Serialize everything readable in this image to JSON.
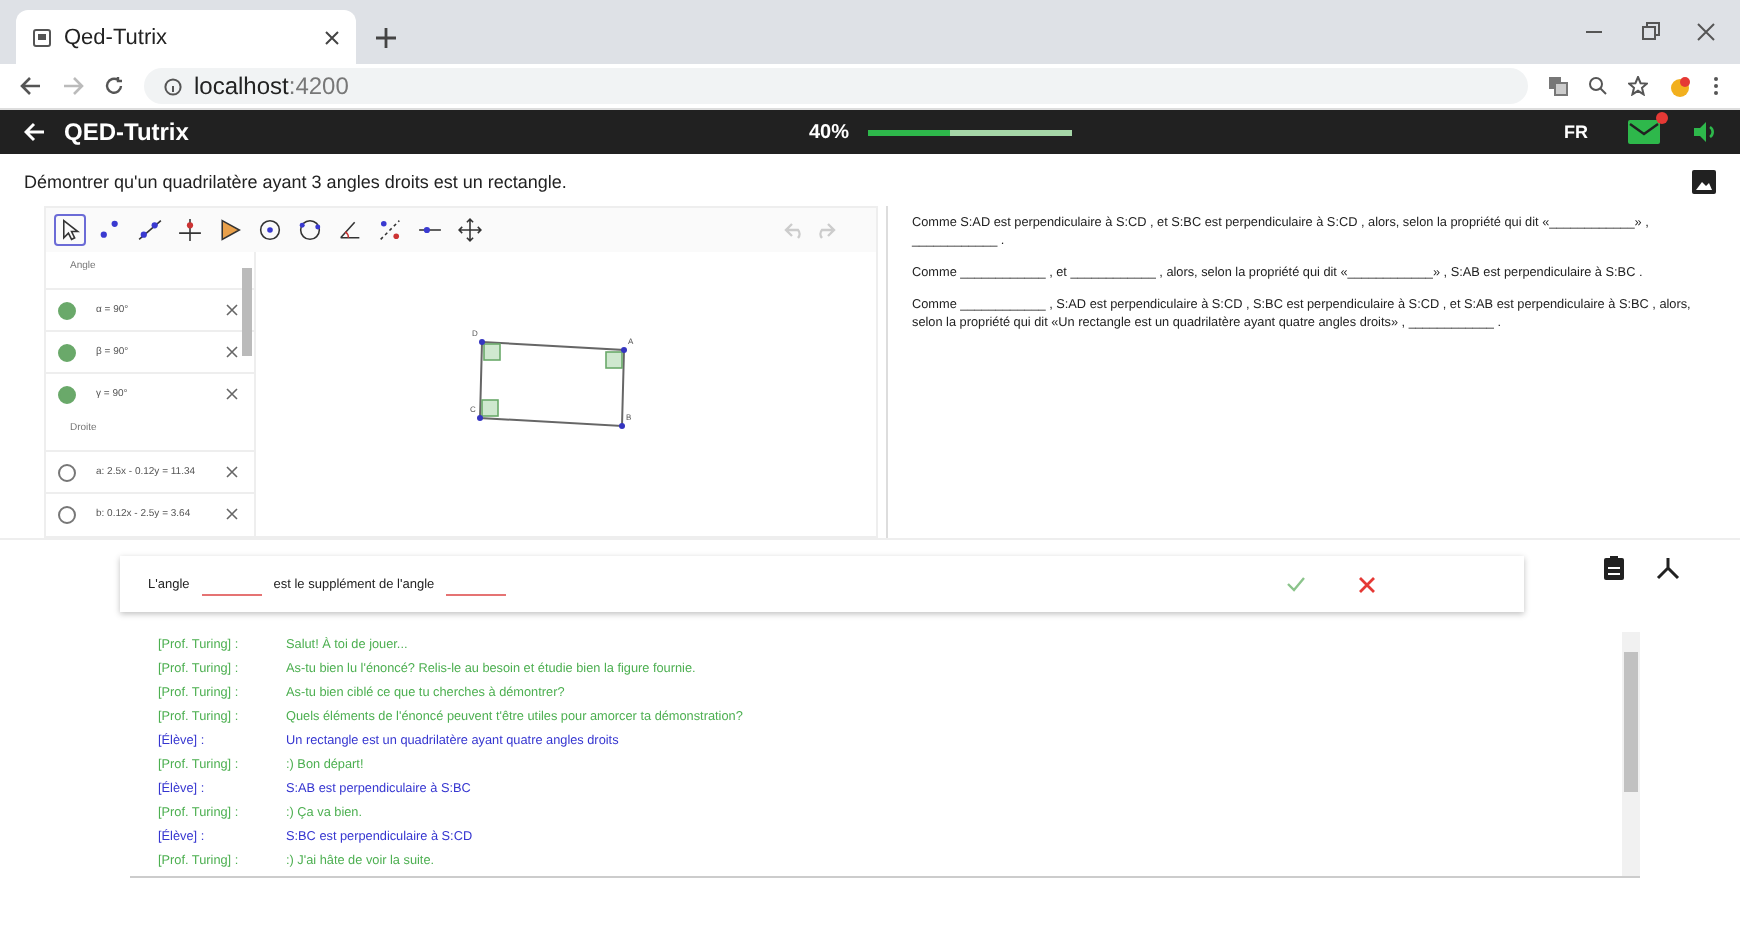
{
  "browser": {
    "tab_title": "Qed-Tutrix",
    "url_host": "localhost",
    "url_port": ":4200"
  },
  "app_bar": {
    "title": "QED-Tutrix",
    "progress_text": "40%",
    "level": 0.4,
    "language": "FR",
    "notification": true
  },
  "problem": {
    "statement": "Démontrer qu'un quadrilatère ayant 3 angles droits est un rectangle."
  },
  "geometry": {
    "tools": [
      {
        "kind": "move",
        "selected": true
      },
      {
        "kind": "point",
        "selected": false
      },
      {
        "kind": "line",
        "selected": false
      },
      {
        "kind": "perpendicular",
        "selected": false
      },
      {
        "kind": "polygon",
        "selected": false
      },
      {
        "kind": "circle",
        "selected": false
      },
      {
        "kind": "circle3",
        "selected": false
      },
      {
        "kind": "angle",
        "selected": false
      },
      {
        "kind": "reflect",
        "selected": false
      },
      {
        "kind": "slider",
        "selected": false
      },
      {
        "kind": "pan",
        "selected": false
      }
    ],
    "algebra": [
      {
        "title": "Angle",
        "items": [
          {
            "label": "α = 90°",
            "visible": true
          },
          {
            "label": "β = 90°",
            "visible": true
          },
          {
            "label": "γ = 90°",
            "visible": true
          }
        ]
      },
      {
        "title": "Droite",
        "items": [
          {
            "label": "a: 2.5x - 0.12y = 11.34",
            "visible": false
          },
          {
            "label": "b: 0.12x - 2.5y = 3.64",
            "visible": false
          }
        ]
      }
    ],
    "points": [
      "D",
      "A",
      "C",
      "B"
    ]
  },
  "proof": {
    "paragraphs": [
      "Comme S:AD est perpendiculaire à S:CD , et S:BC est perpendiculaire à S:CD , alors, selon la propriété qui dit «____________» , ____________ .",
      "Comme ____________ , et ____________ , alors, selon la propriété qui dit «____________» , S:AB est perpendiculaire à S:BC .",
      "Comme ____________ , S:AD est perpendiculaire à S:CD , S:BC est perpendiculaire à S:CD , et S:AB est perpendiculaire à S:BC , alors, selon la propriété qui dit «Un rectangle est un quadrilatère ayant quatre angles droits» , ____________ ."
    ]
  },
  "answer": {
    "parts": [
      {
        "kind": "text",
        "text": "L'angle"
      },
      {
        "kind": "field"
      },
      {
        "kind": "text",
        "text": "est le supplément de l'angle"
      },
      {
        "kind": "field"
      }
    ]
  },
  "chat": [
    {
      "kind": "tutor",
      "speaker": "[Prof. Turing] :",
      "text": "Salut! À toi de jouer..."
    },
    {
      "kind": "tutor",
      "speaker": "[Prof. Turing] :",
      "text": "As-tu bien lu l'énoncé? Relis-le au besoin et étudie bien la figure fournie."
    },
    {
      "kind": "tutor",
      "speaker": "[Prof. Turing] :",
      "text": "As-tu bien ciblé ce que tu cherches à démontrer?"
    },
    {
      "kind": "tutor",
      "speaker": "[Prof. Turing] :",
      "text": "Quels éléments de l'énoncé peuvent t'être utiles pour amorcer ta démonstration?"
    },
    {
      "kind": "student",
      "speaker": "[Élève] :",
      "text": "Un rectangle est un quadrilatère ayant quatre angles droits"
    },
    {
      "kind": "tutor",
      "speaker": "[Prof. Turing] :",
      "text": ":) Bon départ!"
    },
    {
      "kind": "student",
      "speaker": "[Élève] :",
      "text": "S:AB est perpendiculaire à S:BC"
    },
    {
      "kind": "tutor",
      "speaker": "[Prof. Turing] :",
      "text": ":) Ça va bien."
    },
    {
      "kind": "student",
      "speaker": "[Élève] :",
      "text": "S:BC est perpendiculaire à S:CD"
    },
    {
      "kind": "tutor",
      "speaker": "[Prof. Turing] :",
      "text": ":) J'ai hâte de voir la suite."
    }
  ]
}
